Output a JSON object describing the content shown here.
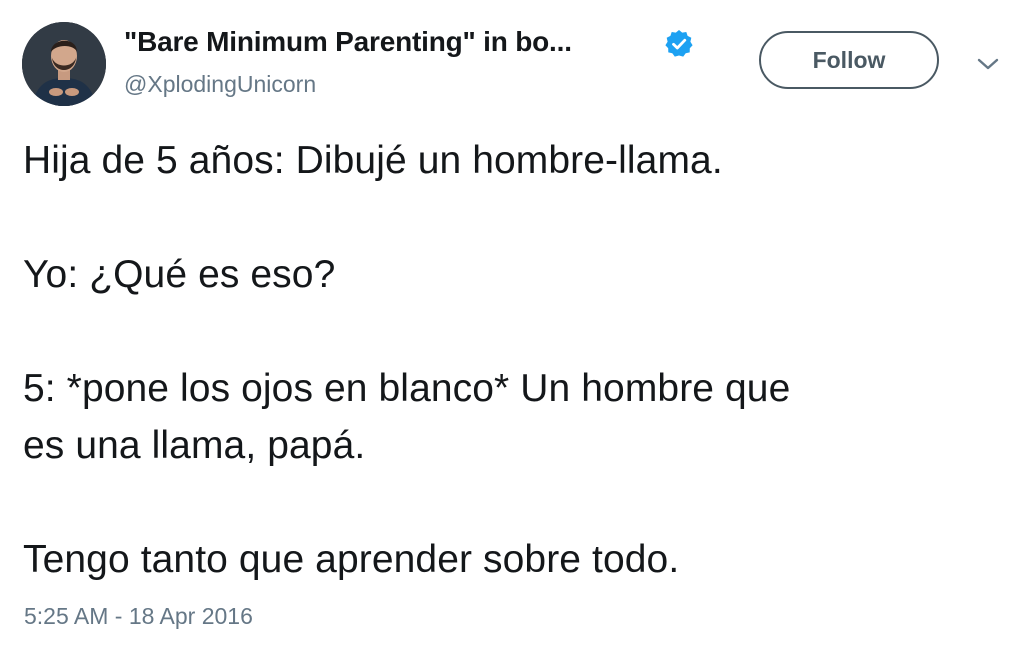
{
  "header": {
    "display_name": "\"Bare Minimum Parenting\" in bo...",
    "handle": "@XplodingUnicorn",
    "follow_label": "Follow",
    "avatar_icon": "avatar-photo",
    "verified_icon": "verified-badge-icon",
    "menu_icon": "chevron-down-icon"
  },
  "tweet": {
    "lines": {
      "l1": "Hija de 5 años: Dibujé un hombre-llama.",
      "l2": "Yo: ¿Qué es eso?",
      "l3": "5: *pone los ojos en blanco* Un hombre que",
      "l4": "es una llama, papá.",
      "l5": "Tengo tanto que aprender sobre todo."
    },
    "timestamp": "5:25 AM - 18 Apr 2016"
  },
  "colors": {
    "text": "#14171a",
    "secondary": "#657786",
    "verified": "#1da1f2",
    "follow_border": "#4a5963"
  }
}
